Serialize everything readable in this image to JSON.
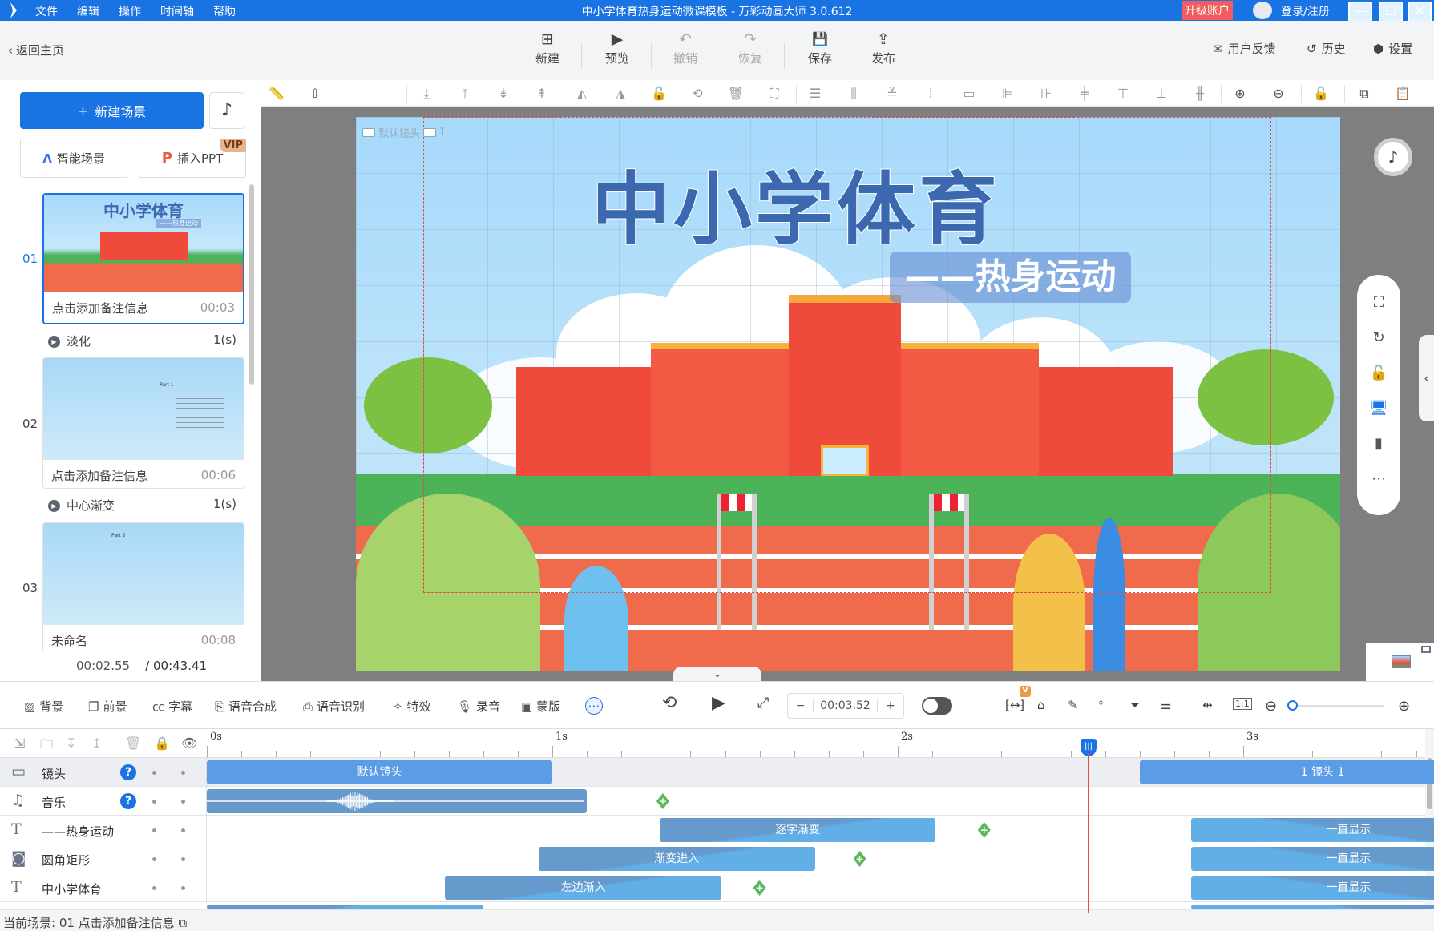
{
  "titlebar": {
    "menu": [
      "文件",
      "编辑",
      "操作",
      "时间轴",
      "帮助"
    ],
    "title": "中小学体育热身运动微课模板 - 万彩动画大师 3.0.612",
    "upgrade": "升级账户",
    "login": "登录/注册",
    "minimize": "—",
    "maximize": "☐",
    "close": "✕"
  },
  "toolbar": {
    "back": "返回主页",
    "buttons": [
      {
        "label": "新建",
        "icon": "plus-square-icon",
        "glyph": "⊞",
        "enabled": true
      },
      {
        "label": "预览",
        "icon": "play-icon",
        "glyph": "▶",
        "enabled": true
      },
      {
        "label": "撤销",
        "icon": "undo-icon",
        "glyph": "↶",
        "enabled": false
      },
      {
        "label": "恢复",
        "icon": "redo-icon",
        "glyph": "↷",
        "enabled": false
      },
      {
        "label": "保存",
        "icon": "save-icon",
        "glyph": "💾",
        "enabled": true
      },
      {
        "label": "发布",
        "icon": "publish-icon",
        "glyph": "⇪",
        "enabled": true
      }
    ],
    "right": [
      {
        "label": "用户反馈",
        "glyph": "✉"
      },
      {
        "label": "历史",
        "glyph": "↺"
      },
      {
        "label": "设置",
        "glyph": "⬢"
      }
    ]
  },
  "sidebar": {
    "new_scene": "新建场景",
    "smart_scene": "智能场景",
    "insert_ppt": "插入PPT",
    "vip": "VIP",
    "scenes": [
      {
        "num": "01",
        "note": "点击添加备注信息",
        "duration": "00:03",
        "selected": true,
        "thumb_title": "中小学体育",
        "thumb_sub": "——热身运动"
      },
      {
        "num": "02",
        "note": "点击添加备注信息",
        "duration": "00:06",
        "selected": false,
        "thumb_title": "Part 1"
      },
      {
        "num": "03",
        "note": "未命名",
        "duration": "00:08",
        "selected": false,
        "thumb_title": "Part 2"
      }
    ],
    "transitions": [
      {
        "name": "淡化",
        "duration": "1(s)"
      },
      {
        "name": "中心渐变",
        "duration": "1(s)"
      }
    ],
    "current_time": "00:02.55",
    "total_time": "/ 00:43.41"
  },
  "canvas": {
    "camera_labels": [
      "默认镜头",
      "1"
    ],
    "title": "中小学体育",
    "subtitle": "——热身运动"
  },
  "bottom_toolbar": {
    "items": [
      {
        "label": "背景",
        "glyph": "▨"
      },
      {
        "label": "前景",
        "glyph": "❐"
      },
      {
        "label": "字幕",
        "glyph": "㏄"
      },
      {
        "label": "语音合成",
        "glyph": "⎘"
      },
      {
        "label": "语音识别",
        "glyph": "⎙"
      },
      {
        "label": "特效",
        "glyph": "✧"
      },
      {
        "label": "录音",
        "glyph": "🎙"
      },
      {
        "label": "蒙版",
        "glyph": "▣"
      }
    ],
    "more": "⋯",
    "time_value": "00:03.52",
    "minus": "−",
    "plus": "+",
    "vip_badge": "V"
  },
  "timeline": {
    "ruler_labels": [
      "0s",
      "1s",
      "2s",
      "3s"
    ],
    "tracks": [
      {
        "name": "镜头",
        "icon": "▭",
        "help": true
      },
      {
        "name": "音乐",
        "icon": "♫",
        "help": true
      },
      {
        "name": "——热身运动",
        "icon": "T",
        "help": false
      },
      {
        "name": "圆角矩形",
        "icon": "◙",
        "help": false
      },
      {
        "name": "中小学体育",
        "icon": "T",
        "help": false
      }
    ],
    "clips": {
      "camera": [
        {
          "label": "默认镜头",
          "start": 0,
          "end": 1.0
        },
        {
          "label": "1 镜头 1",
          "start": 2.7,
          "end": 3.5
        }
      ],
      "music": {
        "start": 0,
        "end": 1.1
      },
      "subtitle_in": {
        "label": "逐字渐变",
        "start": 1.31,
        "end": 2.11
      },
      "rect_in": {
        "label": "渐变进入",
        "start": 0.96,
        "end": 1.76
      },
      "title_in": {
        "label": "左边渐入",
        "start": 0.69,
        "end": 1.49
      },
      "always": "一直显示"
    },
    "playhead_seconds": 2.55,
    "keyframe_glyph": "+"
  },
  "status": "当前场景: 01   点击添加备注信息"
}
